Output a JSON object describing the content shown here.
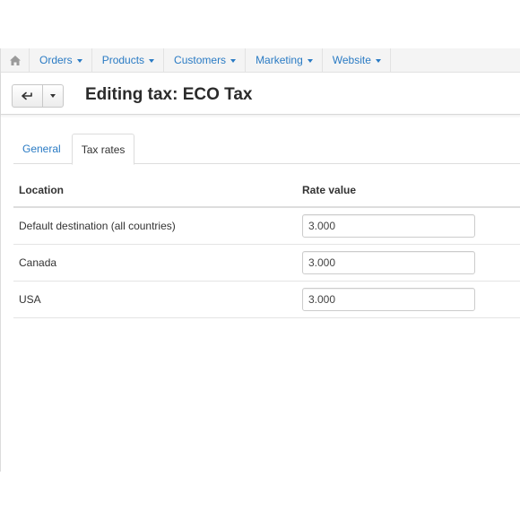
{
  "nav": {
    "home_icon": "home-icon",
    "items": [
      {
        "label": "Orders"
      },
      {
        "label": "Products"
      },
      {
        "label": "Customers"
      },
      {
        "label": "Marketing"
      },
      {
        "label": "Website"
      }
    ]
  },
  "toolbar": {
    "back_icon": "back-arrow-icon",
    "dropdown_icon": "caret-down-icon"
  },
  "page": {
    "title": "Editing tax: ECO Tax"
  },
  "tabs": [
    {
      "label": "General",
      "active": false
    },
    {
      "label": "Tax rates",
      "active": true
    }
  ],
  "table": {
    "headers": {
      "location": "Location",
      "rate": "Rate value"
    },
    "rows": [
      {
        "location": "Default destination (all countries)",
        "rate": "3.000"
      },
      {
        "location": "Canada",
        "rate": "3.000"
      },
      {
        "location": "USA",
        "rate": "3.000"
      }
    ]
  },
  "colors": {
    "link": "#2a7bc4",
    "nav_bg": "#f4f4f4",
    "border": "#dddddd"
  }
}
